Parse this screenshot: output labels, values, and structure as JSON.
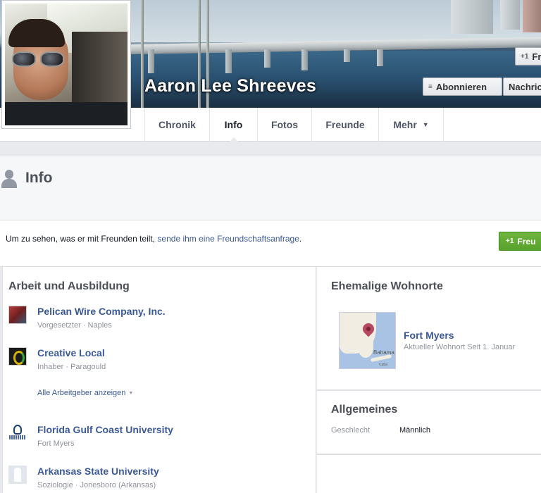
{
  "profile": {
    "name": "Aaron Lee Shreeves"
  },
  "cover_actions": {
    "friend_label": "Fr",
    "subscribe_label": "Abonnieren",
    "message_label": "Nachrich"
  },
  "tabs": [
    {
      "label": "Chronik"
    },
    {
      "label": "Info"
    },
    {
      "label": "Fotos"
    },
    {
      "label": "Freunde"
    },
    {
      "label": "Mehr"
    }
  ],
  "active_tab": "Info",
  "info_header": {
    "title": "Info"
  },
  "friend_notice": {
    "text_before": "Um zu sehen, was er mit Freunden teilt, ",
    "link": "sende ihm eine Freundschaftsanfrage",
    "text_after": ".",
    "button_label": "Freu"
  },
  "work_education": {
    "title": "Arbeit und Ausbildung",
    "employers": [
      {
        "name": "Pelican Wire Company, Inc.",
        "detail": "Vorgesetzter · Naples"
      },
      {
        "name": "Creative Local",
        "detail": "Inhaber · Paragould"
      }
    ],
    "show_all_label": "Alle Arbeitgeber anzeigen",
    "schools": [
      {
        "name": "Florida Gulf Coast University",
        "detail": "Fort Myers"
      },
      {
        "name": "Arkansas State University",
        "detail": "Soziologie · Jonesboro (Arkansas)"
      }
    ]
  },
  "places": {
    "title": "Ehemalige Wohnorte",
    "map_label": "Bahama",
    "map_label_small": "Cuba",
    "current": {
      "name": "Fort Myers",
      "detail": "Aktueller Wohnort Seit 1. Januar"
    }
  },
  "basic_info": {
    "title": "Allgemeines",
    "gender_label": "Geschlecht",
    "gender_value": "Männlich"
  },
  "colors": {
    "link_blue": "#3b5998",
    "add_friend_green": "#5fa833",
    "page_bg": "#e9eaed"
  }
}
